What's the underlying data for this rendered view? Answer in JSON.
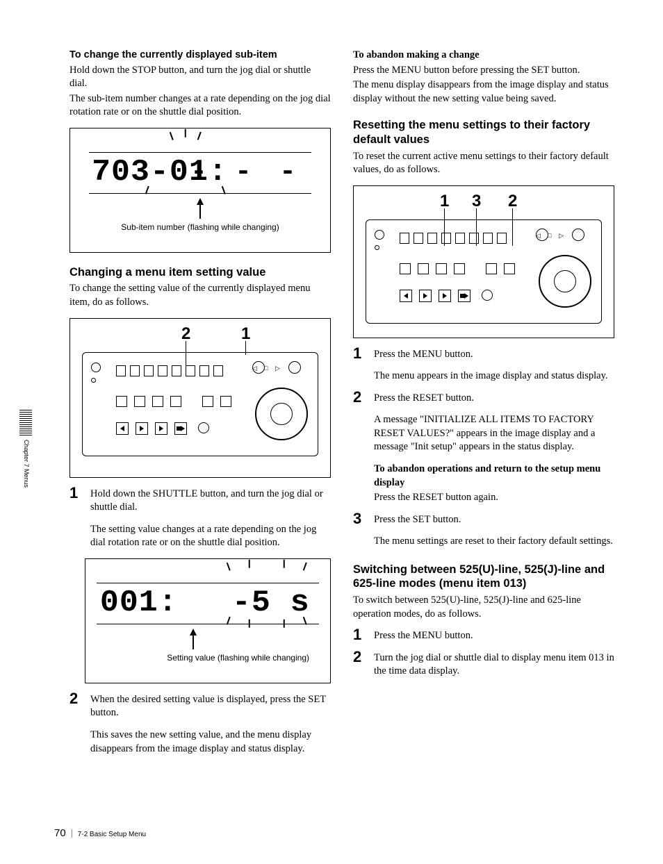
{
  "left": {
    "h_change_sub": "To change the currently displayed sub-item",
    "p_change_sub_1": "Hold down the STOP button, and turn the jog dial or shuttle dial.",
    "p_change_sub_2": "The sub-item number changes at a rate depending on the jog dial rotation rate or on the shuttle dial position.",
    "fig1_lcd": "703-01:",
    "fig1_dashes": "- - -",
    "fig1_caption": "Sub-item number (flashing while changing)",
    "h_change_value": "Changing a menu item setting value",
    "p_change_value": "To change the setting value of the currently displayed menu item, do as follows.",
    "fig2_callout_2": "2",
    "fig2_callout_1": "1",
    "step1_num": "1",
    "step1_text": "Hold down the SHUTTLE button, and turn the jog dial or shuttle dial.",
    "step1_sub": "The setting value changes at a rate depending on the jog dial rotation rate or on the shuttle dial position.",
    "fig3_lcd": "001:",
    "fig3_value": "-5 s",
    "fig3_caption": "Setting value (flashing while changing)",
    "step2_num": "2",
    "step2_text": "When the desired setting value is displayed, press the SET button.",
    "step2_sub": "This saves the new setting value, and the menu display disappears from the image display and status display."
  },
  "right": {
    "h_abandon": "To abandon making a change",
    "p_abandon_1": "Press the MENU button before pressing the SET button.",
    "p_abandon_2": "The menu display disappears from the image display and status display without the new setting value being saved.",
    "h_reset": "Resetting the menu settings to their factory default values",
    "p_reset": "To reset the current active menu settings to their factory default values, do as follows.",
    "fig_callout_1": "1",
    "fig_callout_3": "3",
    "fig_callout_2": "2",
    "r_step1_num": "1",
    "r_step1_text": "Press the MENU button.",
    "r_step1_sub": "The menu appears in the image display and status display.",
    "r_step2_num": "2",
    "r_step2_text": "Press the RESET button.",
    "r_step2_sub": "A message \"INITIALIZE ALL ITEMS TO FACTORY RESET VALUES?\" appears in the image display and a message \"Init setup\" appears in the status display.",
    "r_step2_h": "To abandon operations and return to the setup menu display",
    "r_step2_h_sub": "Press the RESET button again.",
    "r_step3_num": "3",
    "r_step3_text": "Press the SET button.",
    "r_step3_sub": "The menu settings are reset to their factory default settings.",
    "h_switch": "Switching between 525(U)-line, 525(J)-line and 625-line modes (menu item 013)",
    "p_switch": "To switch between 525(U)-line, 525(J)-line and 625-line operation modes, do as follows.",
    "s_step1_num": "1",
    "s_step1_text": "Press the MENU button.",
    "s_step2_num": "2",
    "s_step2_text": "Turn the jog dial or shuttle dial to display menu item 013 in the time data display."
  },
  "sidebar": "Chapter 7  Menus",
  "footer": {
    "page": "70",
    "section": "7-2 Basic Setup Menu"
  }
}
